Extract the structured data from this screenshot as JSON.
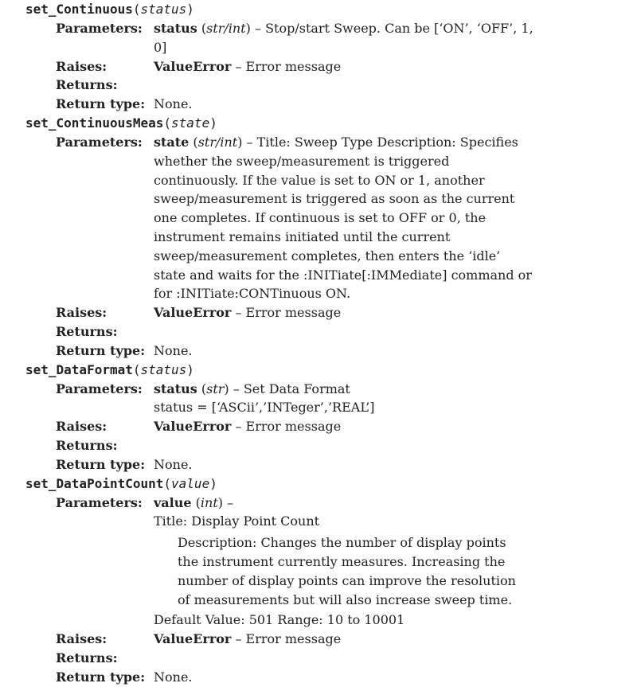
{
  "methods": [
    {
      "name": "set_Continuous",
      "param": "status",
      "parameters_label": "Parameters:",
      "p_name": "status",
      "p_type": "str/int",
      "p_desc": "– Stop/start Sweep. Can be [‘ON’, ‘OFF’, 1, 0]",
      "raises_label": "Raises:",
      "raises_name": "ValueError",
      "raises_desc": "– Error message",
      "returns_label": "Returns:",
      "return_type_label": "Return type:",
      "return_type": "None."
    },
    {
      "name": "set_ContinuousMeas",
      "param": "state",
      "parameters_label": "Parameters:",
      "p_name": "state",
      "p_type": "str/int",
      "p_desc": "– Title: Sweep Type Description: Specifies whether the sweep/measurement is triggered continuously. If the value is set to ON or 1, another sweep/measurement is triggered as soon as the current one completes. If continuous is set to OFF or 0, the instrument remains initiated until the current sweep/measurement completes, then enters the ‘idle’ state and waits for the :INITiate[:IMMediate] command or for :INITiate:CONTinuous ON.",
      "raises_label": "Raises:",
      "raises_name": "ValueError",
      "raises_desc": "– Error message",
      "returns_label": "Returns:",
      "return_type_label": "Return type:",
      "return_type": "None."
    },
    {
      "name": "set_DataFormat",
      "param": "status",
      "parameters_label": "Parameters:",
      "p_name": "status",
      "p_type": "str",
      "p_desc": "– Set Data Format status = [‘ASCii’,’INTeger’,’REAL’]",
      "raises_label": "Raises:",
      "raises_name": "ValueError",
      "raises_desc": "– Error message",
      "returns_label": "Returns:",
      "return_type_label": "Return type:",
      "return_type": "None."
    },
    {
      "name": "set_DataPointCount",
      "param": "value",
      "parameters_label": "Parameters:",
      "p_name": "value",
      "p_type": "int",
      "p_desc": "–",
      "p_title": "Title: Display Point Count",
      "p_description": "Description: Changes the number of display points the instrument currently measures. Increasing the number of display points can improve the resolution of measurements but will also increase sweep time.",
      "p_default": "Default Value: 501 Range: 10 to 10001",
      "raises_label": "Raises:",
      "raises_name": "ValueError",
      "raises_desc": "– Error message",
      "returns_label": "Returns:",
      "return_type_label": "Return type:",
      "return_type": "None."
    }
  ]
}
